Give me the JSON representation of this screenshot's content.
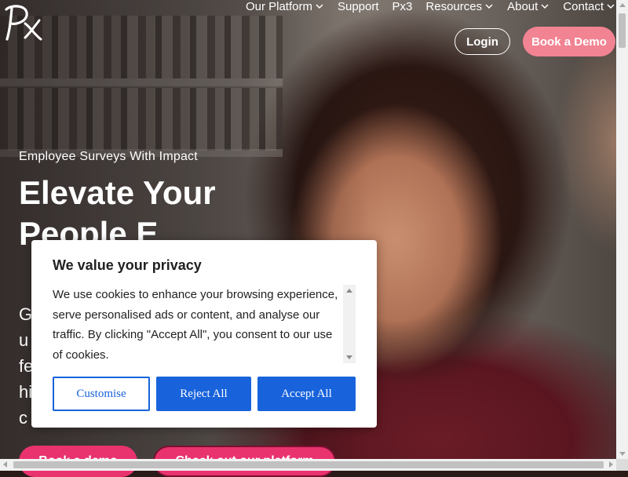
{
  "brand": {
    "logo_text": "Px"
  },
  "nav": {
    "items": [
      {
        "label": "Our Platform",
        "has_dropdown": true
      },
      {
        "label": "Support",
        "has_dropdown": false
      },
      {
        "label": "Px3",
        "has_dropdown": false
      },
      {
        "label": "Resources",
        "has_dropdown": true
      },
      {
        "label": "About",
        "has_dropdown": true
      },
      {
        "label": "Contact",
        "has_dropdown": true
      }
    ],
    "login_label": "Login",
    "book_demo_label": "Book a Demo"
  },
  "hero": {
    "eyebrow": "Employee Surveys With Impact",
    "headline": "Elevate Your People E",
    "subcopy": "G u fe hi c",
    "cta_primary": "Book a demo",
    "cta_secondary": "Check out our platform"
  },
  "cookie_banner": {
    "title": "We value your privacy",
    "body": "We use cookies to enhance your browsing experience, serve personalised ads or content, and analyse our traffic. By clicking \"Accept All\", you consent to our use of cookies.",
    "customise_label": "Customise",
    "reject_label": "Reject All",
    "accept_label": "Accept All"
  },
  "colors": {
    "accent_pink": "#f28392",
    "cta_pink": "#e8336e",
    "consent_blue": "#1863dc"
  }
}
